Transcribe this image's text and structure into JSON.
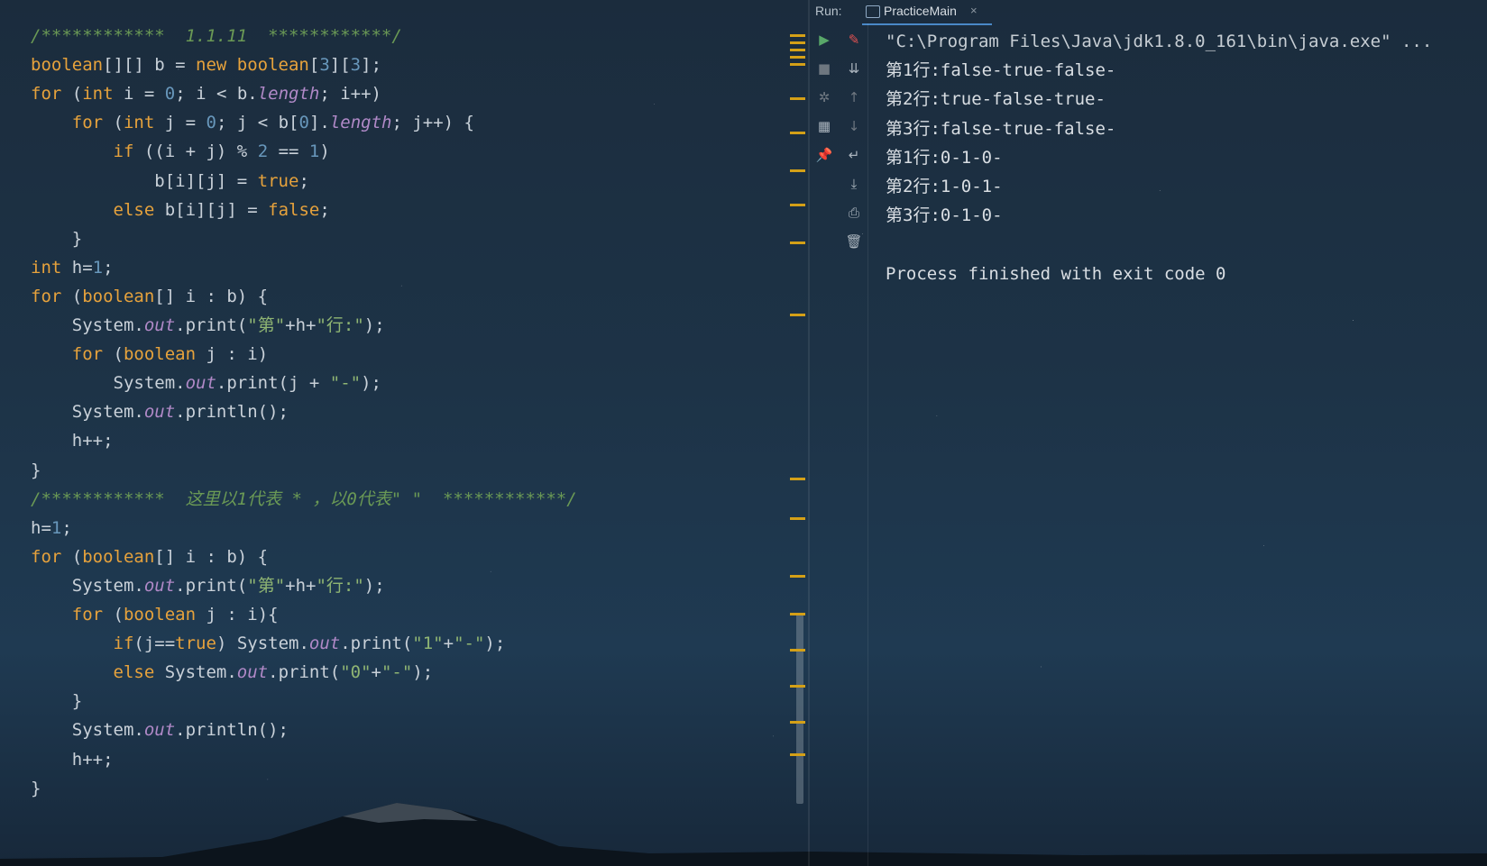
{
  "editor": {
    "lines": [
      {
        "tokens": [
          {
            "c": "t-com",
            "t": "/************  1.1.11  ************/"
          }
        ]
      },
      {
        "tokens": [
          {
            "c": "t-ty",
            "t": "boolean"
          },
          {
            "c": "t-pl",
            "t": "[][] b = "
          },
          {
            "c": "t-kw",
            "t": "new boolean"
          },
          {
            "c": "t-pl",
            "t": "["
          },
          {
            "c": "t-num",
            "t": "3"
          },
          {
            "c": "t-pl",
            "t": "]["
          },
          {
            "c": "t-num",
            "t": "3"
          },
          {
            "c": "t-pl",
            "t": "];"
          }
        ]
      },
      {
        "tokens": [
          {
            "c": "t-kw",
            "t": "for"
          },
          {
            "c": "t-pl",
            "t": " ("
          },
          {
            "c": "t-kw",
            "t": "int"
          },
          {
            "c": "t-pl",
            "t": " i = "
          },
          {
            "c": "t-num",
            "t": "0"
          },
          {
            "c": "t-pl",
            "t": "; i < b."
          },
          {
            "c": "t-fld",
            "t": "length"
          },
          {
            "c": "t-pl",
            "t": "; i++)"
          }
        ]
      },
      {
        "tokens": [
          {
            "c": "t-pl",
            "t": "    "
          },
          {
            "c": "t-kw",
            "t": "for"
          },
          {
            "c": "t-pl",
            "t": " ("
          },
          {
            "c": "t-kw",
            "t": "int"
          },
          {
            "c": "t-pl",
            "t": " j = "
          },
          {
            "c": "t-num",
            "t": "0"
          },
          {
            "c": "t-pl",
            "t": "; j < b["
          },
          {
            "c": "t-num",
            "t": "0"
          },
          {
            "c": "t-pl",
            "t": "]."
          },
          {
            "c": "t-fld",
            "t": "length"
          },
          {
            "c": "t-pl",
            "t": "; j++) {"
          }
        ]
      },
      {
        "tokens": [
          {
            "c": "t-pl",
            "t": "        "
          },
          {
            "c": "t-kw",
            "t": "if"
          },
          {
            "c": "t-pl",
            "t": " ((i + j) % "
          },
          {
            "c": "t-num",
            "t": "2"
          },
          {
            "c": "t-pl",
            "t": " == "
          },
          {
            "c": "t-num",
            "t": "1"
          },
          {
            "c": "t-pl",
            "t": ")"
          }
        ]
      },
      {
        "tokens": [
          {
            "c": "t-pl",
            "t": "            b[i][j] = "
          },
          {
            "c": "t-kw",
            "t": "true"
          },
          {
            "c": "t-pl",
            "t": ";"
          }
        ]
      },
      {
        "tokens": [
          {
            "c": "t-pl",
            "t": "        "
          },
          {
            "c": "t-kw",
            "t": "else"
          },
          {
            "c": "t-pl",
            "t": " b[i][j] = "
          },
          {
            "c": "t-kw",
            "t": "false"
          },
          {
            "c": "t-pl",
            "t": ";"
          }
        ]
      },
      {
        "tokens": [
          {
            "c": "t-pl",
            "t": "    }"
          }
        ]
      },
      {
        "tokens": [
          {
            "c": "t-kw",
            "t": "int"
          },
          {
            "c": "t-pl",
            "t": " h="
          },
          {
            "c": "t-num",
            "t": "1"
          },
          {
            "c": "t-pl",
            "t": ";"
          }
        ]
      },
      {
        "tokens": [
          {
            "c": "t-kw",
            "t": "for"
          },
          {
            "c": "t-pl",
            "t": " ("
          },
          {
            "c": "t-kw",
            "t": "boolean"
          },
          {
            "c": "t-pl",
            "t": "[] i : b) {"
          }
        ]
      },
      {
        "tokens": [
          {
            "c": "t-pl",
            "t": "    System."
          },
          {
            "c": "t-fld",
            "t": "out"
          },
          {
            "c": "t-pl",
            "t": ".print("
          },
          {
            "c": "t-str",
            "t": "\"第\""
          },
          {
            "c": "t-pl",
            "t": "+h+"
          },
          {
            "c": "t-str",
            "t": "\"行:\""
          },
          {
            "c": "t-pl",
            "t": ");"
          }
        ]
      },
      {
        "tokens": [
          {
            "c": "t-pl",
            "t": "    "
          },
          {
            "c": "t-kw",
            "t": "for"
          },
          {
            "c": "t-pl",
            "t": " ("
          },
          {
            "c": "t-kw",
            "t": "boolean"
          },
          {
            "c": "t-pl",
            "t": " j : i)"
          }
        ]
      },
      {
        "tokens": [
          {
            "c": "t-pl",
            "t": "        System."
          },
          {
            "c": "t-fld",
            "t": "out"
          },
          {
            "c": "t-pl",
            "t": ".print(j + "
          },
          {
            "c": "t-str",
            "t": "\"-\""
          },
          {
            "c": "t-pl",
            "t": ");"
          }
        ]
      },
      {
        "tokens": [
          {
            "c": "t-pl",
            "t": "    System."
          },
          {
            "c": "t-fld",
            "t": "out"
          },
          {
            "c": "t-pl",
            "t": ".println();"
          }
        ]
      },
      {
        "tokens": [
          {
            "c": "t-pl",
            "t": "    h++;"
          }
        ]
      },
      {
        "tokens": [
          {
            "c": "t-pl",
            "t": "}"
          }
        ]
      },
      {
        "tokens": [
          {
            "c": "t-com",
            "t": "/************  这里以1代表 * ，以0代表\" \"  ************/"
          }
        ]
      },
      {
        "tokens": [
          {
            "c": "t-pl",
            "t": "h="
          },
          {
            "c": "t-num",
            "t": "1"
          },
          {
            "c": "t-pl",
            "t": ";"
          }
        ]
      },
      {
        "tokens": [
          {
            "c": "t-kw",
            "t": "for"
          },
          {
            "c": "t-pl",
            "t": " ("
          },
          {
            "c": "t-kw",
            "t": "boolean"
          },
          {
            "c": "t-pl",
            "t": "[] i : b) {"
          }
        ]
      },
      {
        "tokens": [
          {
            "c": "t-pl",
            "t": "    System."
          },
          {
            "c": "t-fld",
            "t": "out"
          },
          {
            "c": "t-pl",
            "t": ".print("
          },
          {
            "c": "t-str",
            "t": "\"第\""
          },
          {
            "c": "t-pl",
            "t": "+h+"
          },
          {
            "c": "t-str",
            "t": "\"行:\""
          },
          {
            "c": "t-pl",
            "t": ");"
          }
        ]
      },
      {
        "tokens": [
          {
            "c": "t-pl",
            "t": "    "
          },
          {
            "c": "t-kw",
            "t": "for"
          },
          {
            "c": "t-pl",
            "t": " ("
          },
          {
            "c": "t-kw",
            "t": "boolean"
          },
          {
            "c": "t-pl",
            "t": " j : i){"
          }
        ]
      },
      {
        "tokens": [
          {
            "c": "t-pl",
            "t": "        "
          },
          {
            "c": "t-kw",
            "t": "if"
          },
          {
            "c": "t-pl",
            "t": "(j=="
          },
          {
            "c": "t-kw",
            "t": "true"
          },
          {
            "c": "t-pl",
            "t": ") System."
          },
          {
            "c": "t-fld",
            "t": "out"
          },
          {
            "c": "t-pl",
            "t": ".print("
          },
          {
            "c": "t-str",
            "t": "\"1\""
          },
          {
            "c": "t-pl",
            "t": "+"
          },
          {
            "c": "t-str",
            "t": "\"-\""
          },
          {
            "c": "t-pl",
            "t": ");"
          }
        ]
      },
      {
        "tokens": [
          {
            "c": "t-pl",
            "t": "        "
          },
          {
            "c": "t-kw",
            "t": "else"
          },
          {
            "c": "t-pl",
            "t": " System."
          },
          {
            "c": "t-fld",
            "t": "out"
          },
          {
            "c": "t-pl",
            "t": ".print("
          },
          {
            "c": "t-str",
            "t": "\"0\""
          },
          {
            "c": "t-pl",
            "t": "+"
          },
          {
            "c": "t-str",
            "t": "\"-\""
          },
          {
            "c": "t-pl",
            "t": ");"
          }
        ]
      },
      {
        "tokens": [
          {
            "c": "t-pl",
            "t": "    }"
          }
        ]
      },
      {
        "tokens": [
          {
            "c": "t-pl",
            "t": "    System."
          },
          {
            "c": "t-fld",
            "t": "out"
          },
          {
            "c": "t-pl",
            "t": ".println();"
          }
        ]
      },
      {
        "tokens": [
          {
            "c": "t-pl",
            "t": "    h++;"
          }
        ]
      },
      {
        "tokens": [
          {
            "c": "t-pl",
            "t": "}"
          }
        ]
      }
    ]
  },
  "run": {
    "label": "Run:",
    "tab_label": "PracticeMain",
    "tab_close": "×",
    "toolbar_left": [
      {
        "name": "rerun-icon",
        "glyph": "▶",
        "color": "#59a869"
      },
      {
        "name": "stop-icon",
        "glyph": "■",
        "color": "#6e7780"
      },
      {
        "name": "settings-icon",
        "glyph": "✲",
        "color": "#6e7780"
      },
      {
        "name": "layout-icon",
        "glyph": "▦",
        "color": "#aab4bd"
      },
      {
        "name": "pin-icon",
        "glyph": "📌",
        "color": "#aab4bd"
      }
    ],
    "toolbar_right": [
      {
        "name": "edit-config-icon",
        "glyph": "✎",
        "color": "#e05252"
      },
      {
        "name": "sort-icon",
        "glyph": "⇊",
        "color": "#aab4bd"
      },
      {
        "name": "up-arrow-icon",
        "glyph": "↑",
        "color": "#6e7780"
      },
      {
        "name": "down-arrow-icon",
        "glyph": "↓",
        "color": "#6e7780"
      },
      {
        "name": "soft-wrap-icon",
        "glyph": "↵",
        "color": "#aab4bd"
      },
      {
        "name": "scroll-to-end-icon",
        "glyph": "⤓",
        "color": "#aab4bd"
      },
      {
        "name": "print-icon",
        "glyph": "⎙",
        "color": "#aab4bd"
      },
      {
        "name": "trash-icon",
        "glyph": "🗑",
        "color": "#aab4bd"
      }
    ],
    "console": [
      "\"C:\\Program Files\\Java\\jdk1.8.0_161\\bin\\java.exe\" ...",
      "第1行:false-true-false-",
      "第2行:true-false-true-",
      "第3行:false-true-false-",
      "第1行:0-1-0-",
      "第2行:1-0-1-",
      "第3行:0-1-0-",
      "",
      "Process finished with exit code 0"
    ]
  }
}
